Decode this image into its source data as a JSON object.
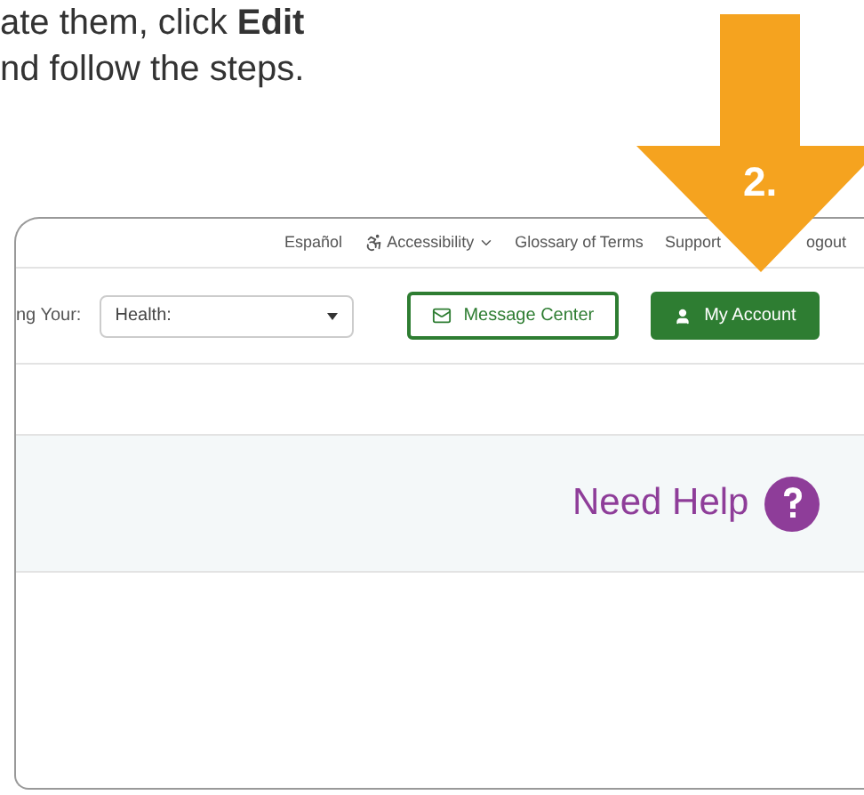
{
  "instructions": [
    "ate them, click **Edit**",
    "nd follow the steps."
  ],
  "step_arrow": {
    "label": "2."
  },
  "top_nav": [
    "Español",
    "Accessibility",
    "Glossary of Terms",
    "Support",
    "ogout"
  ],
  "toolbar": {
    "label": "ng Your:",
    "select": {
      "value": "Health:"
    },
    "buttons": [
      {
        "label": "Message Center",
        "kind": "outline"
      },
      {
        "label": "My Account",
        "kind": "solid"
      }
    ]
  },
  "help_panel": {
    "label": "Need Help"
  }
}
